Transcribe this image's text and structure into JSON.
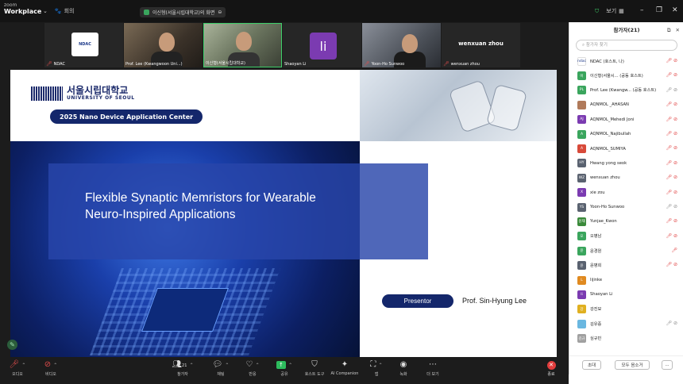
{
  "topbar": {
    "brand_top": "zoom",
    "brand_bottom": "Workplace",
    "meeting_label": "회의",
    "share_title": "이신형(서울시립대학교)의 화면",
    "view_label": "보기"
  },
  "thumbnails": [
    {
      "name": "NDAC",
      "logo": "NDAC"
    },
    {
      "name": "Prof. Lee (Kwangwoon Uni...)"
    },
    {
      "name": "이신형(서울시립대학교)"
    },
    {
      "name": "Shaoyan Li",
      "avatar": "li"
    },
    {
      "name": "Yoon-Ho Sunwoo"
    },
    {
      "name": "wenxuan zhou",
      "display": "wenxuan zhou"
    }
  ],
  "slide": {
    "univ_ko": "서울시립대학교",
    "univ_en": "UNIVERSITY OF SEOUL",
    "center_name": "2025 Nano Device Application Center",
    "title_line1": "Flexible Synaptic Memristors for Wearable",
    "title_line2": "Neuro-Inspired Applications",
    "presenter_label": "Presentor",
    "presenter_name": "Prof. Sin-Hyung Lee"
  },
  "panel": {
    "title": "참가자(21)",
    "search_placeholder": "참가자 찾기",
    "participants": [
      {
        "initials": "ndac",
        "name": "NDAC (호스트, 나)",
        "color": "#ffffff"
      },
      {
        "initials": "이",
        "name": "이신형(서울시... (공동 호스트)",
        "color": "#3aa55d"
      },
      {
        "initials": "PL",
        "name": "Prof. Lee (Kwangw... (공동 호스트)",
        "color": "#3aa55d"
      },
      {
        "initials": "",
        "name": "AQNMOL _AHASAN",
        "color": "#b07a5a"
      },
      {
        "initials": "AJ",
        "name": "AQNMOL_Mehedi Joni",
        "color": "#7b3bb1"
      },
      {
        "initials": "A",
        "name": "AQNMOL_Najibullah",
        "color": "#3aa55d"
      },
      {
        "initials": "A",
        "name": "AQNMOL_SUMIYA",
        "color": "#d84a3a"
      },
      {
        "initials": "HY",
        "name": "Hwang yong seok",
        "color": "#5a6270"
      },
      {
        "initials": "WZ",
        "name": "wenxuan zhou",
        "color": "#5a6270"
      },
      {
        "initials": "X",
        "name": "xie zou",
        "color": "#7b3bb1"
      },
      {
        "initials": "YS",
        "name": "Yoon-Ho Sunwoo",
        "color": "#5a6270"
      },
      {
        "initials": "윤재",
        "name": "Yunjae_Kwon",
        "color": "#3a8a3a"
      },
      {
        "initials": "오",
        "name": "오병남",
        "color": "#3aa55d"
      },
      {
        "initials": "윤",
        "name": "윤경원",
        "color": "#3aa55d"
      },
      {
        "initials": "윤",
        "name": "윤병희",
        "color": "#5a6270"
      },
      {
        "initials": "L",
        "name": "lijinke",
        "color": "#e08a20"
      },
      {
        "initials": "li",
        "name": "Shaoyan Li",
        "color": "#7b3bb1"
      },
      {
        "initials": "강",
        "name": "강진묘",
        "color": "#e0b020"
      },
      {
        "initials": "",
        "name": "김유중",
        "color": "#6ab7e0"
      },
      {
        "initials": "김규",
        "name": "심규민",
        "color": "#a0a0a0"
      }
    ],
    "invite_label": "초대",
    "mute_all_label": "모두 음소거",
    "more_label": "..."
  },
  "toolbar": {
    "audio": "오디오",
    "video": "비디오",
    "participants": "참가자",
    "participants_count": "21",
    "chat": "채팅",
    "reactions": "반응",
    "share": "공유",
    "host_tools": "호스트 도구",
    "ai": "AI Companion",
    "apps": "앱",
    "record": "녹화",
    "more": "더 보기",
    "end": "종료"
  }
}
